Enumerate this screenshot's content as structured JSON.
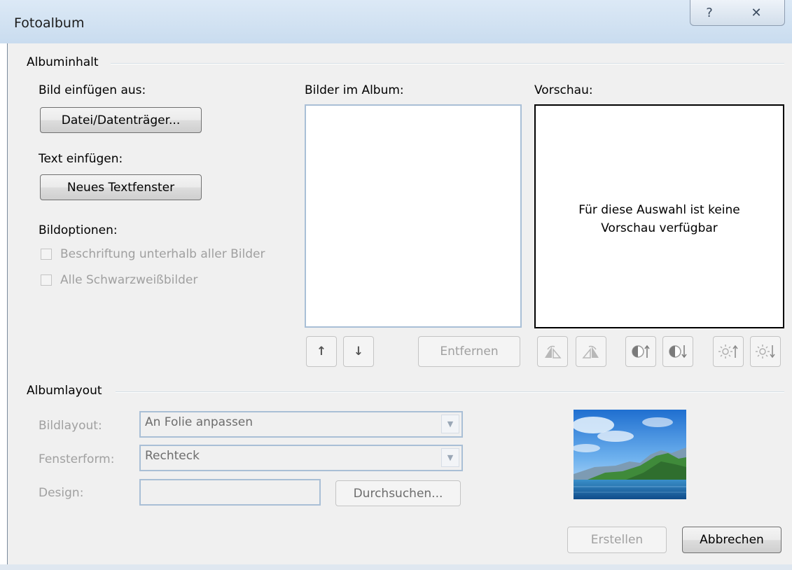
{
  "window": {
    "title": "Fotoalbum",
    "help_glyph": "?",
    "close_glyph": "✕"
  },
  "content_group": {
    "label": "Albuminhalt",
    "insert_picture_label": "Bild einfügen aus:",
    "file_button": "Datei/Datenträger...",
    "insert_text_label": "Text einfügen:",
    "new_textbox_button": "Neues Textfenster",
    "picture_options_label": "Bildoptionen:",
    "caption_option": "Beschriftung unterhalb aller Bilder",
    "bw_option": "Alle Schwarzweißbilder",
    "pictures_in_album_label": "Bilder im Album:",
    "preview_label": "Vorschau:",
    "preview_message_line1": "Für diese Auswahl ist keine",
    "preview_message_line2": "Vorschau verfügbar",
    "move_up_glyph": "↑",
    "move_down_glyph": "↓",
    "remove_button": "Entfernen"
  },
  "layout_group": {
    "label": "Albumlayout",
    "picture_layout_label": "Bildlayout:",
    "picture_layout_value": "An Folie anpassen",
    "frame_shape_label": "Fensterform:",
    "frame_shape_value": "Rechteck",
    "theme_label": "Design:",
    "theme_value": "",
    "browse_button": "Durchsuchen..."
  },
  "footer": {
    "create_button": "Erstellen",
    "cancel_button": "Abbrechen"
  },
  "icons": {
    "rotate_left": "rotate-left-icon",
    "rotate_right": "rotate-right-icon",
    "contrast_up": "contrast-up-icon",
    "contrast_down": "contrast-down-icon",
    "brightness_up": "brightness-up-icon",
    "brightness_down": "brightness-down-icon"
  },
  "colors": {
    "title_bar": "#c9dcef",
    "dialog_bg": "#f0f0f0",
    "list_border": "#a9bfd6",
    "disabled_text": "#a0a0a0"
  }
}
